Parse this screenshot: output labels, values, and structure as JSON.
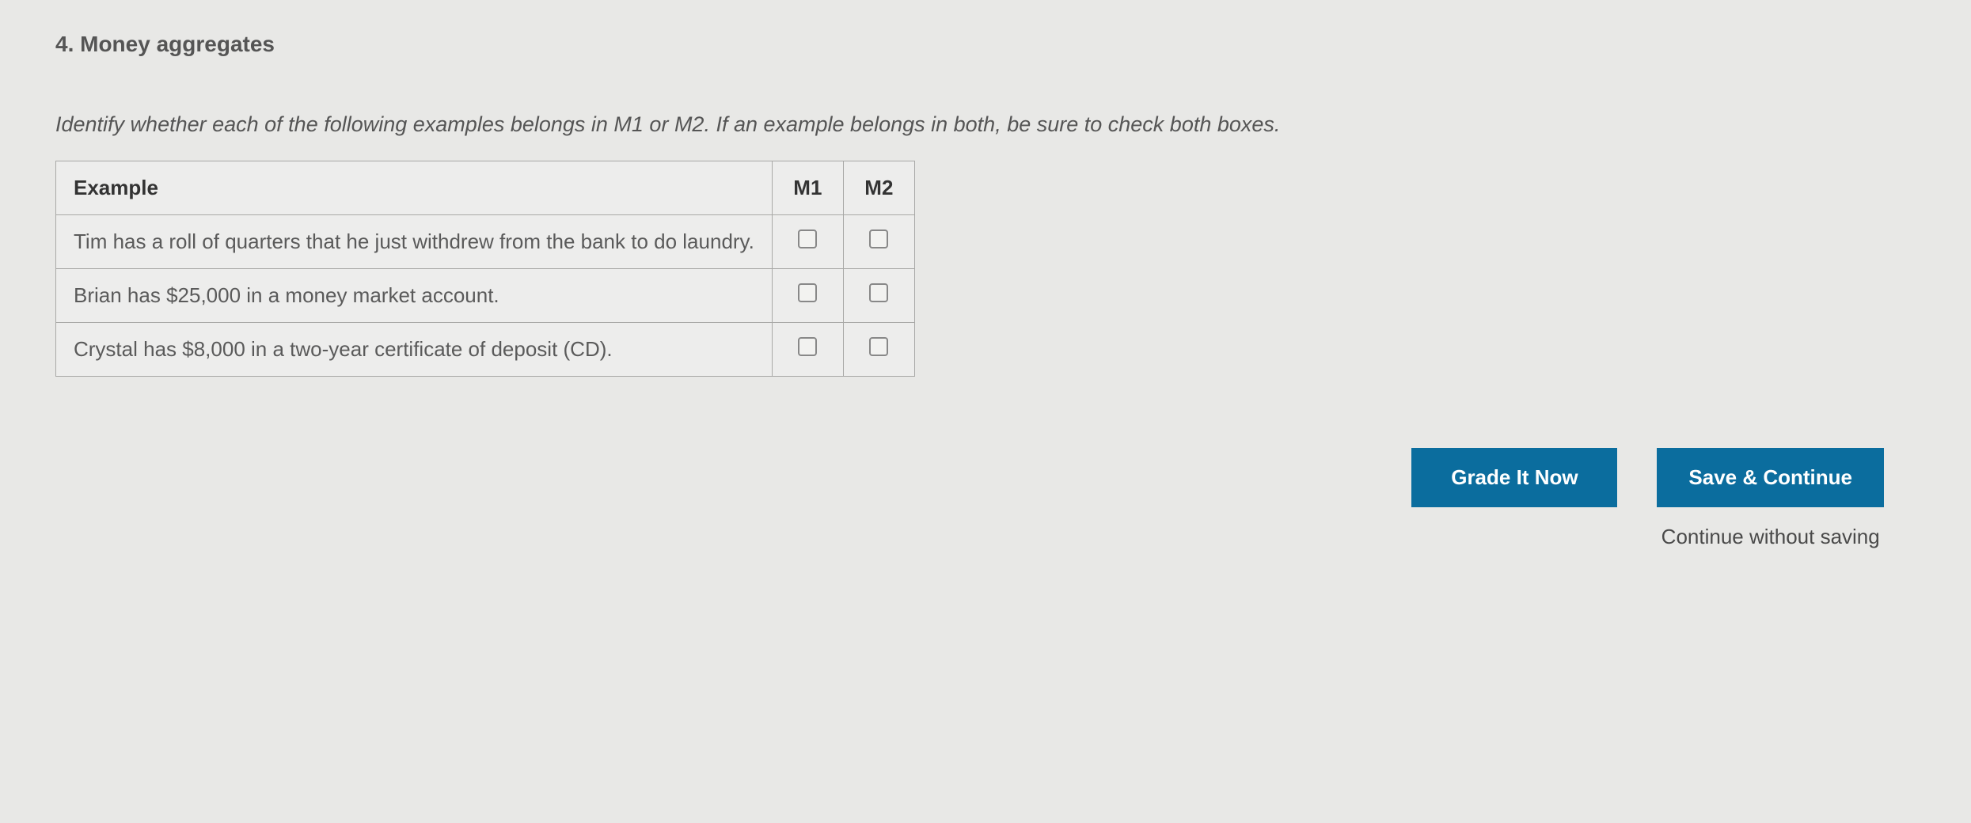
{
  "question": {
    "number_title": "4. Money aggregates",
    "instructions": "Identify whether each of the following examples belongs in M1 or M2. If an example belongs in both, be sure to check both boxes."
  },
  "table": {
    "headers": {
      "example": "Example",
      "m1": "M1",
      "m2": "M2"
    },
    "rows": [
      {
        "text": "Tim has a roll of quarters that he just withdrew from the bank to do laundry."
      },
      {
        "text": "Brian has $25,000 in a money market account."
      },
      {
        "text": "Crystal has $8,000 in a two-year certificate of deposit (CD)."
      }
    ]
  },
  "actions": {
    "grade": "Grade It Now",
    "save_continue": "Save & Continue",
    "continue_no_save": "Continue without saving"
  }
}
